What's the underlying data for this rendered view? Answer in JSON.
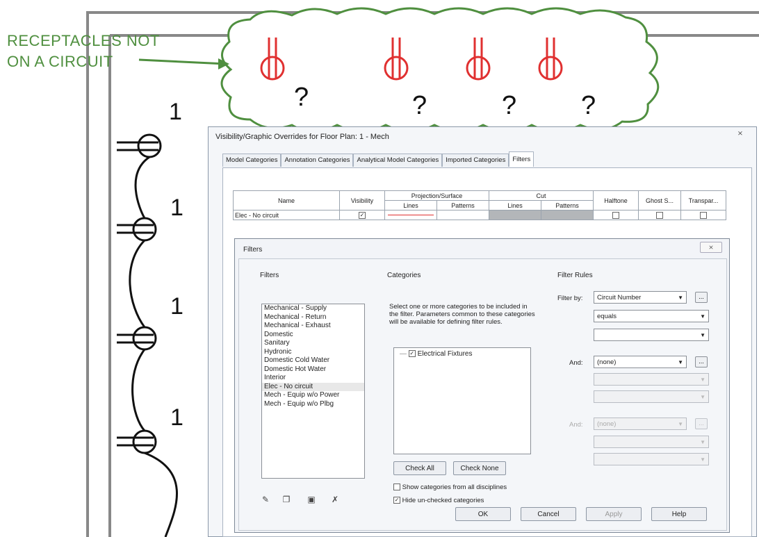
{
  "callout": {
    "line1": "RECEPTACLES NOT",
    "line2": "ON A CIRCUIT",
    "marks": [
      "?",
      "?",
      "?",
      "?"
    ],
    "color": "#4f8f3f",
    "symbol_color": "#e03030"
  },
  "circuit_numbers": [
    "1",
    "1",
    "1",
    "1"
  ],
  "vg_dialog": {
    "title": "Visibility/Graphic Overrides for Floor Plan: 1 - Mech",
    "close": "⨯",
    "tabs": [
      "Model Categories",
      "Annotation Categories",
      "Analytical Model Categories",
      "Imported Categories",
      "Filters"
    ],
    "table": {
      "headers": {
        "name": "Name",
        "visibility": "Visibility",
        "projection": "Projection/Surface",
        "cut": "Cut",
        "halftone": "Halftone",
        "ghost": "Ghost S...",
        "transparent": "Transpar...",
        "lines": "Lines",
        "patterns": "Patterns"
      },
      "row": {
        "name": "Elec - No circuit",
        "visible": true
      }
    }
  },
  "filters_dialog": {
    "title": "Filters",
    "close": "⨯",
    "filters_label": "Filters",
    "categories_label": "Categories",
    "rules_label": "Filter Rules",
    "filters": [
      "Mechanical - Supply",
      "Mechanical - Return",
      "Mechanical - Exhaust",
      "Domestic",
      "Sanitary",
      "Hydronic",
      "Domestic Cold Water",
      "Domestic Hot Water",
      "Interior",
      "Elec - No circuit",
      "Mech - Equip w/o Power",
      "Mech - Equip w/o Plbg"
    ],
    "selected_filter": "Elec - No circuit",
    "categories_help": "Select one or more categories to be included in the filter.  Parameters common to these categories will be available for defining filter rules.",
    "category_item": "Electrical Fixtures",
    "check_all": "Check All",
    "check_none": "Check None",
    "show_all_disciplines": "Show categories from all disciplines",
    "show_all_checked": false,
    "hide_unchecked": "Hide un-checked categories",
    "hide_unchecked_checked": true,
    "filter_by_label": "Filter by:",
    "filter_by_value": "Circuit Number",
    "operator_value": "equals",
    "and1_label": "And:",
    "and1_value": "(none)",
    "and2_label": "And:",
    "and2_value": "(none)",
    "ellipsis": "...",
    "buttons": {
      "ok": "OK",
      "cancel": "Cancel",
      "apply": "Apply",
      "help": "Help"
    }
  }
}
